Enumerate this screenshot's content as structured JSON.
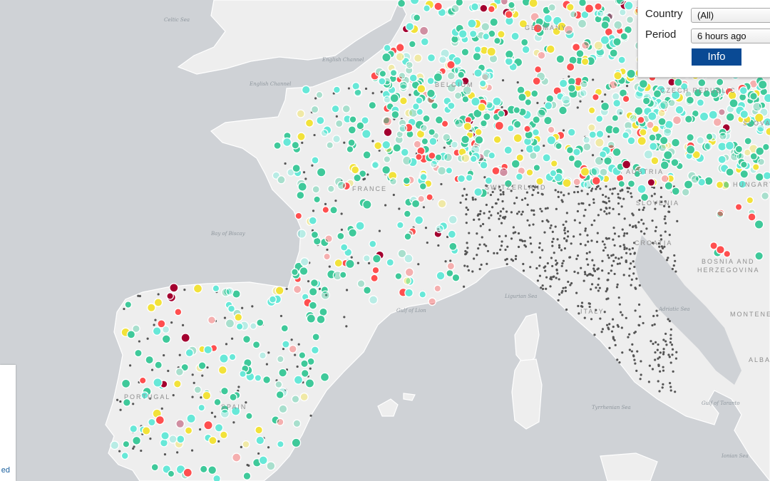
{
  "map": {
    "colors": {
      "sea": "#cfd2d6",
      "land": "#eeeeee",
      "good": "#3fc99a",
      "fair": "#67e8d8",
      "moderate": "#f2e23a",
      "poor": "#ff4f4f",
      "very_poor": "#a3002f",
      "station": "#555555"
    },
    "sea_labels": [
      "Celtic Sea",
      "English Channel",
      "English Channel",
      "Bay of Biscay",
      "Gulf of Lion",
      "Ligurian Sea",
      "Adriatic Sea",
      "Tyrrhenian Sea",
      "Gulf of Taranto",
      "Ionian Sea"
    ],
    "country_labels": [
      "FRANCE",
      "SWITZERLAND",
      "PORTUGAL",
      "SPAIN",
      "ITALY",
      "CROATIA",
      "BOSNIA AND",
      "HERZEGOVINA",
      "HUNGARY",
      "SLOVENIA",
      "AUSTRIA",
      "CZECH REPUBLIC",
      "SLOVAKIA",
      "GERMANY",
      "ALBANIA",
      "MONTENEGRO",
      "BELGIUM"
    ]
  },
  "filters": {
    "country_label": "Country",
    "country_value": "(All)",
    "period_label": "Period",
    "period_value": "6 hours ago",
    "info_button": "Info"
  },
  "legend": {
    "text": "ed"
  }
}
